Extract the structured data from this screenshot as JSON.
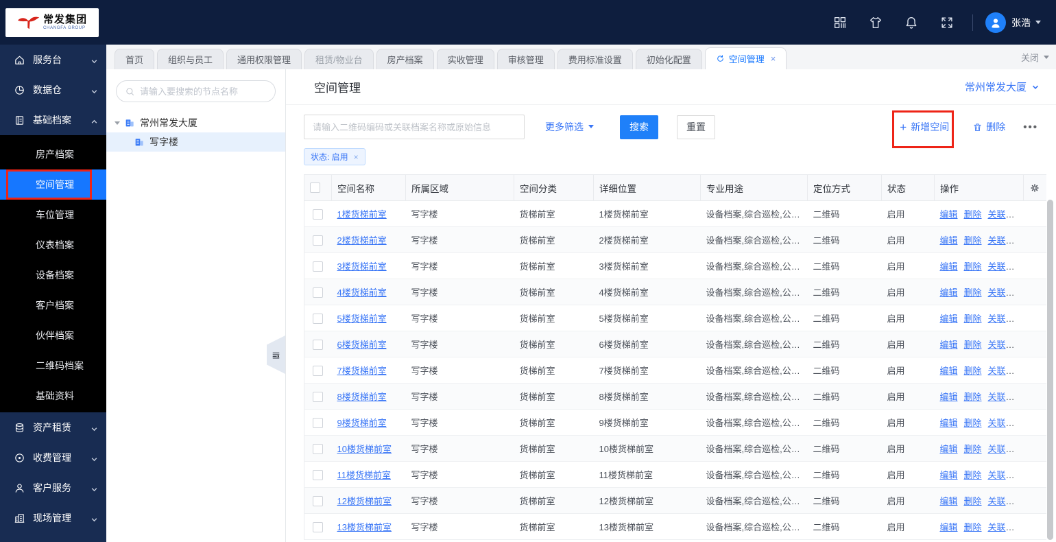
{
  "topbar": {
    "brand": {
      "name": "常发集团",
      "tagline": "CHANGFA GROUP"
    },
    "user_name": "张浩"
  },
  "sidebar": {
    "items": [
      {
        "label": "服务台",
        "icon": "home-icon",
        "chevron": "down"
      },
      {
        "label": "数据仓",
        "icon": "pie-icon",
        "chevron": "down"
      },
      {
        "label": "基础档案",
        "icon": "file-icon",
        "chevron": "up",
        "children": [
          {
            "label": "房产档案"
          },
          {
            "label": "空间管理",
            "active": true
          },
          {
            "label": "车位管理"
          },
          {
            "label": "仪表档案"
          },
          {
            "label": "设备档案"
          },
          {
            "label": "客户档案"
          },
          {
            "label": "伙伴档案"
          },
          {
            "label": "二维码档案"
          },
          {
            "label": "基础资料"
          }
        ]
      },
      {
        "label": "资产租赁",
        "icon": "database-icon",
        "chevron": "down"
      },
      {
        "label": "收费管理",
        "icon": "target-icon",
        "chevron": "down"
      },
      {
        "label": "客户服务",
        "icon": "user-icon",
        "chevron": "down"
      },
      {
        "label": "现场管理",
        "icon": "building-icon",
        "chevron": "down"
      }
    ]
  },
  "tabbar": {
    "tabs": [
      {
        "label": "首页"
      },
      {
        "label": "组织与员工"
      },
      {
        "label": "通用权限管理"
      },
      {
        "label": "租赁/物业台",
        "muted": true
      },
      {
        "label": "房产档案"
      },
      {
        "label": "实收管理"
      },
      {
        "label": "审核管理"
      },
      {
        "label": "费用标准设置"
      },
      {
        "label": "初始化配置"
      },
      {
        "label": "空间管理",
        "active": true
      }
    ],
    "close_label": "关闭"
  },
  "tree": {
    "search_placeholder": "请输入要搜索的节点名称",
    "nodes": [
      {
        "label": "常州常发大厦",
        "level": 0,
        "expanded": true
      },
      {
        "label": "写字楼",
        "level": 1,
        "selected": true
      }
    ]
  },
  "main": {
    "page_title": "空间管理",
    "project_name": "常州常发大厦",
    "filter": {
      "keyword_placeholder": "请输入二维码编码或关联档案名称或原始信息",
      "more_filters_label": "更多筛选",
      "search_label": "搜索",
      "reset_label": "重置"
    },
    "toolbar": {
      "add_label": "新增空间",
      "delete_label": "删除",
      "more_label": "•••"
    },
    "filter_tag": "状态: 启用",
    "table": {
      "columns": [
        "空间名称",
        "所属区域",
        "空间分类",
        "详细位置",
        "专业用途",
        "定位方式",
        "状态",
        "操作"
      ],
      "op_labels": [
        "编辑",
        "删除",
        "关联工单"
      ],
      "rows": [
        {
          "name": "1楼货梯前室",
          "area": "写字楼",
          "category": "货梯前室",
          "location": "1楼货梯前室",
          "usage": "设备档案,综合巡检,公区...",
          "positioning": "二维码",
          "status": "启用"
        },
        {
          "name": "2楼货梯前室",
          "area": "写字楼",
          "category": "货梯前室",
          "location": "2楼货梯前室",
          "usage": "设备档案,综合巡检,公区...",
          "positioning": "二维码",
          "status": "启用"
        },
        {
          "name": "3楼货梯前室",
          "area": "写字楼",
          "category": "货梯前室",
          "location": "3楼货梯前室",
          "usage": "设备档案,综合巡检,公区...",
          "positioning": "二维码",
          "status": "启用"
        },
        {
          "name": "4楼货梯前室",
          "area": "写字楼",
          "category": "货梯前室",
          "location": "4楼货梯前室",
          "usage": "设备档案,综合巡检,公区...",
          "positioning": "二维码",
          "status": "启用"
        },
        {
          "name": "5楼货梯前室",
          "area": "写字楼",
          "category": "货梯前室",
          "location": "5楼货梯前室",
          "usage": "设备档案,综合巡检,公区...",
          "positioning": "二维码",
          "status": "启用"
        },
        {
          "name": "6楼货梯前室",
          "area": "写字楼",
          "category": "货梯前室",
          "location": "6楼货梯前室",
          "usage": "设备档案,综合巡检,公区...",
          "positioning": "二维码",
          "status": "启用"
        },
        {
          "name": "7楼货梯前室",
          "area": "写字楼",
          "category": "货梯前室",
          "location": "7楼货梯前室",
          "usage": "设备档案,综合巡检,公区...",
          "positioning": "二维码",
          "status": "启用"
        },
        {
          "name": "8楼货梯前室",
          "area": "写字楼",
          "category": "货梯前室",
          "location": "8楼货梯前室",
          "usage": "设备档案,综合巡检,公区...",
          "positioning": "二维码",
          "status": "启用"
        },
        {
          "name": "9楼货梯前室",
          "area": "写字楼",
          "category": "货梯前室",
          "location": "9楼货梯前室",
          "usage": "设备档案,综合巡检,公区...",
          "positioning": "二维码",
          "status": "启用"
        },
        {
          "name": "10楼货梯前室",
          "area": "写字楼",
          "category": "货梯前室",
          "location": "10楼货梯前室",
          "usage": "设备档案,综合巡检,公区...",
          "positioning": "二维码",
          "status": "启用"
        },
        {
          "name": "11楼货梯前室",
          "area": "写字楼",
          "category": "货梯前室",
          "location": "11楼货梯前室",
          "usage": "设备档案,综合巡检,公区...",
          "positioning": "二维码",
          "status": "启用"
        },
        {
          "name": "12楼货梯前室",
          "area": "写字楼",
          "category": "货梯前室",
          "location": "12楼货梯前室",
          "usage": "设备档案,综合巡检,公区...",
          "positioning": "二维码",
          "status": "启用"
        },
        {
          "name": "13楼货梯前室",
          "area": "写字楼",
          "category": "货梯前室",
          "location": "13楼货梯前室",
          "usage": "设备档案,综合巡检,公区...",
          "positioning": "二维码",
          "status": "启用"
        }
      ]
    }
  },
  "colors": {
    "topbar_bg": "#0e1e3e",
    "sidebar_bg": "#182c52",
    "submenu_bg": "#000000",
    "active_nav": "#1677ff",
    "accent_link": "#3875f6",
    "primary_button": "#1f80f9",
    "annotation_red": "#ee2417",
    "tag_bg": "#edf4ff",
    "stripe": "#fafbfc"
  }
}
